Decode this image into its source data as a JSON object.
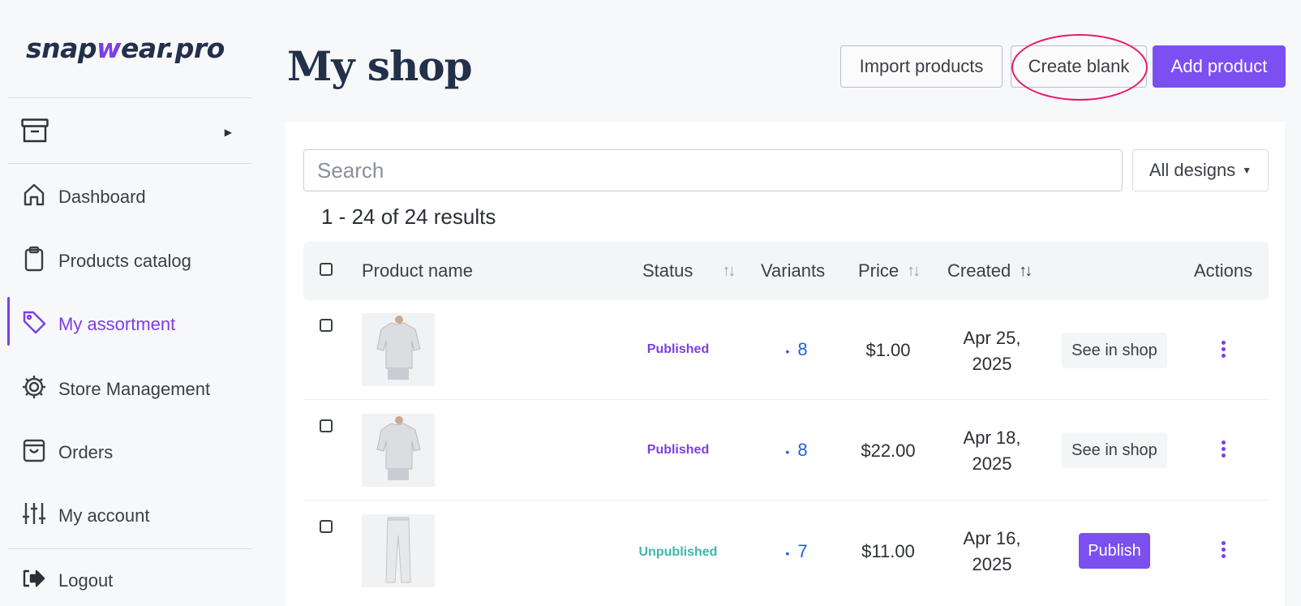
{
  "brand": {
    "logo_pre": "snap",
    "logo_w": "w",
    "logo_post": "ear.pro",
    "accent": "#7b3fe4",
    "title_color": "#22304a"
  },
  "sidebar": {
    "store_switch_icon": "archive-box-icon",
    "items": [
      {
        "label": "Dashboard",
        "icon": "home-icon"
      },
      {
        "label": "Products catalog",
        "icon": "clipboard-icon"
      },
      {
        "label": "My assortment",
        "icon": "tag-icon",
        "active": true
      },
      {
        "label": "Store Management",
        "icon": "gear-icon"
      },
      {
        "label": "Orders",
        "icon": "shopping-bag-icon"
      },
      {
        "label": "My account",
        "icon": "sliders-icon"
      }
    ],
    "logout": {
      "label": "Logout",
      "icon": "logout-icon"
    }
  },
  "header": {
    "title": "My shop",
    "import_label": "Import products",
    "create_blank_label": "Create blank",
    "add_product_label": "Add product",
    "highlight_color": "#e8176f"
  },
  "toolbar": {
    "search_placeholder": "Search",
    "filter_label": "All designs"
  },
  "results_text": "1 - 24 of 24 results",
  "table": {
    "columns": {
      "product_name": "Product name",
      "status": "Status",
      "variants": "Variants",
      "price": "Price",
      "created": "Created",
      "actions": "Actions"
    },
    "rows": [
      {
        "thumb": "shirt",
        "status": "Published",
        "variants_bullet": "•",
        "variants": "8",
        "price": "$1.00",
        "created_1": "Apr 25,",
        "created_2": "2025",
        "action": "See in shop"
      },
      {
        "thumb": "shirt",
        "status": "Published",
        "variants_bullet": "•",
        "variants": "8",
        "price": "$22.00",
        "created_1": "Apr 18,",
        "created_2": "2025",
        "action": "See in shop"
      },
      {
        "thumb": "pants",
        "status": "Unpublished",
        "variants_bullet": "•",
        "variants": "7",
        "price": "$11.00",
        "created_1": "Apr 16,",
        "created_2": "2025",
        "action": "Publish"
      }
    ]
  }
}
